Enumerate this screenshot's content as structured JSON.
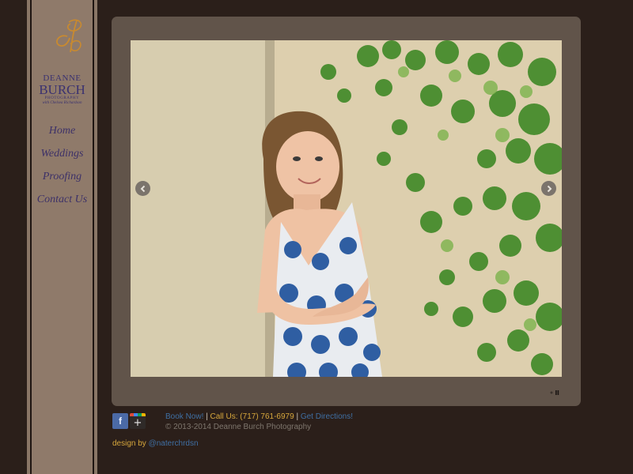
{
  "brand": {
    "monogram": "db",
    "first_name": "DEANNE",
    "last_name": "BURCH",
    "tagline": "PHOTOGRAPHY",
    "subline": "with Chelsea Richardson"
  },
  "nav": {
    "items": [
      {
        "label": "Home"
      },
      {
        "label": "Weddings"
      },
      {
        "label": "Proofing"
      },
      {
        "label": "Contact Us"
      }
    ]
  },
  "slideshow": {
    "prev_icon": "chevron-left-icon",
    "next_icon": "chevron-right-icon",
    "pause_icon": "pause-icon"
  },
  "footer": {
    "book_now": "Book Now!",
    "sep1": " | ",
    "call": "Call Us: (717) 761-6979",
    "sep2": " | ",
    "directions": "Get Directions!",
    "copyright": "© 2013-2014 Deanne Burch Photography",
    "design_prefix": "design by ",
    "design_link": "@naterchrdsn"
  },
  "social": {
    "facebook_icon": "f",
    "googleplus_icon": "+"
  },
  "colors": {
    "background": "#2b1f1a",
    "sidebar": "#8f7a6a",
    "frame": "#61544a",
    "link": "#3f6fa3",
    "accent": "#d7a73c",
    "brand": "#3a3170"
  }
}
